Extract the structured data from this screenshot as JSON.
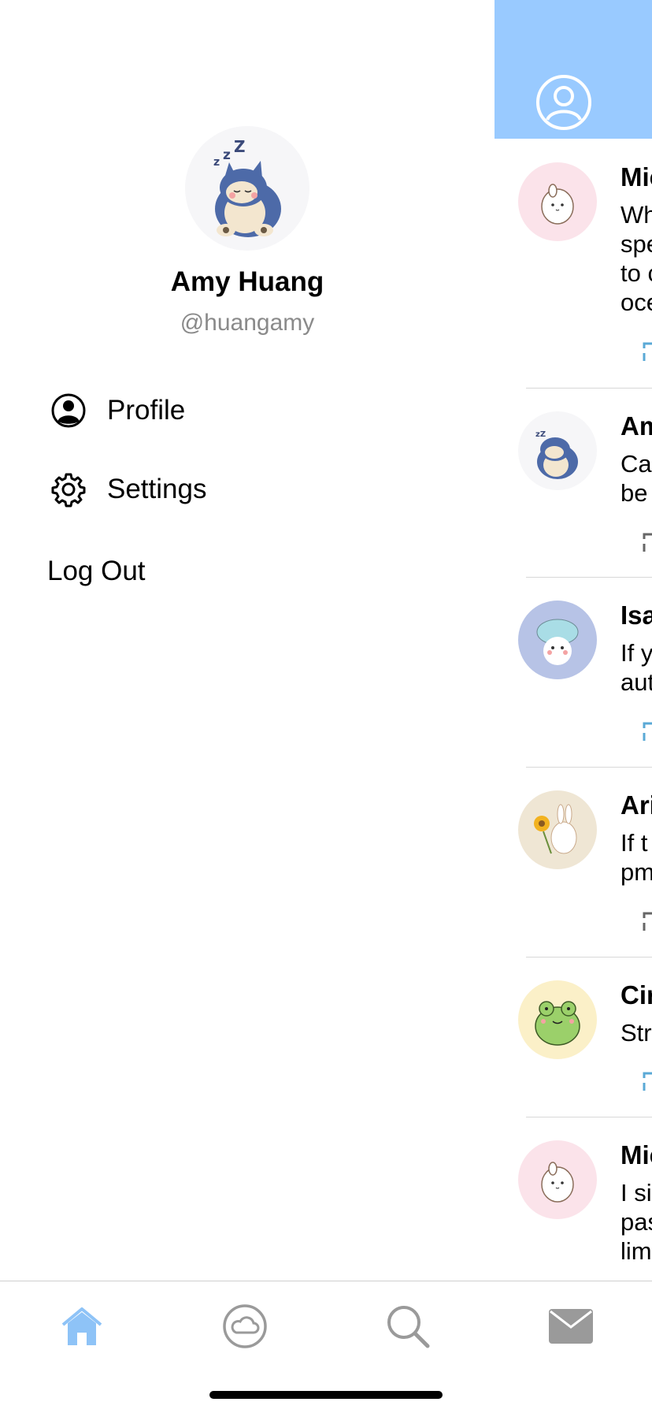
{
  "drawer": {
    "avatar_icon": "snorlax-avatar",
    "name": "Amy Huang",
    "handle": "@huangamy",
    "menu": [
      {
        "label": "Profile",
        "icon": "person-circle-icon"
      },
      {
        "label": "Settings",
        "icon": "gear-icon"
      }
    ],
    "logout_label": "Log Out"
  },
  "feed": {
    "header_color": "#99caff",
    "header_icon": "person-circle-icon",
    "posts": [
      {
        "name": "Mic",
        "lines": "Wh\nspe\nto c\noce",
        "avatar": "molang-avatar"
      },
      {
        "name": "Am",
        "lines": "Ca\nbe",
        "avatar": "snorlax-avatar"
      },
      {
        "name": "Isa",
        "lines": "If y\naut",
        "avatar": "mushroom-avatar"
      },
      {
        "name": "Ari",
        "lines": "If t\npm",
        "avatar": "bunny-sunflower-avatar"
      },
      {
        "name": "Cir",
        "lines": "Str",
        "avatar": "frog-avatar"
      },
      {
        "name": "Mic",
        "lines": "I si\npas\nlim",
        "avatar": "molang-avatar"
      }
    ]
  },
  "tabbar": {
    "accent": "#8ec3f7",
    "tabs": [
      "home-icon",
      "cloud-icon",
      "search-icon",
      "mail-icon"
    ]
  }
}
